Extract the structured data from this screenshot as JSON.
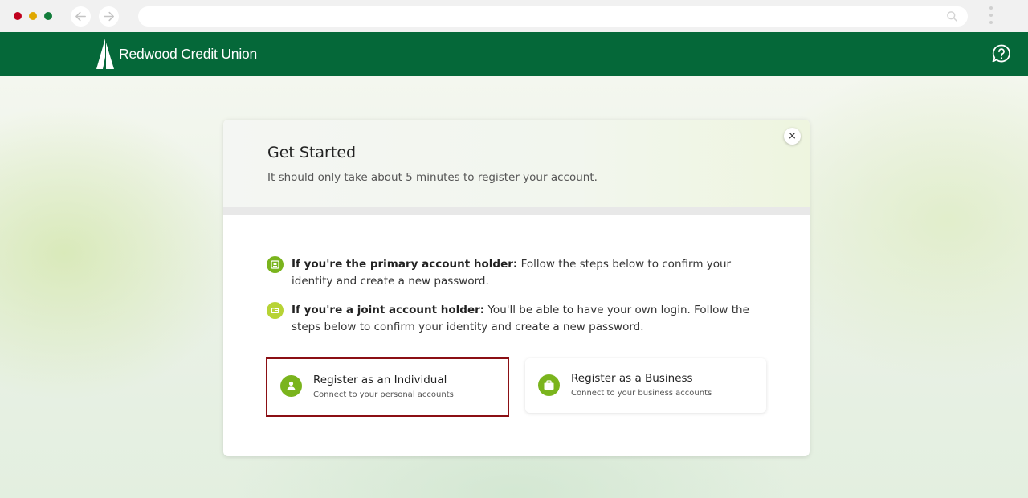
{
  "browser": {
    "back_icon": "arrow-left-icon",
    "forward_icon": "arrow-right-icon",
    "search_icon": "search-icon",
    "menu_icon": "kebab-menu-icon",
    "url": ""
  },
  "header": {
    "brand": "Redwood Credit Union",
    "help_icon": "help-chat-icon",
    "color": "#056839"
  },
  "modal": {
    "title": "Get Started",
    "subtitle": "It should only take about 5 minutes to register your account.",
    "close_label": "×",
    "info": [
      {
        "bold": "If you're the primary account holder:",
        "text": " Follow the steps below to confirm your identity and create a new password.",
        "icon": "id-card-icon"
      },
      {
        "bold": "If you're a joint account holder:",
        "text": " You'll be able to have your own login. Follow the steps below to confirm your identity and create a new password.",
        "icon": "joint-id-icon"
      }
    ],
    "options": [
      {
        "label": "Register as an Individual",
        "description": "Connect to your personal accounts",
        "icon": "person-icon"
      },
      {
        "label": "Register as a Business",
        "description": "Connect to your business accounts",
        "icon": "briefcase-icon"
      }
    ]
  },
  "colors": {
    "accent_green": "#7ab41d",
    "highlight_border": "#8b0f14"
  }
}
